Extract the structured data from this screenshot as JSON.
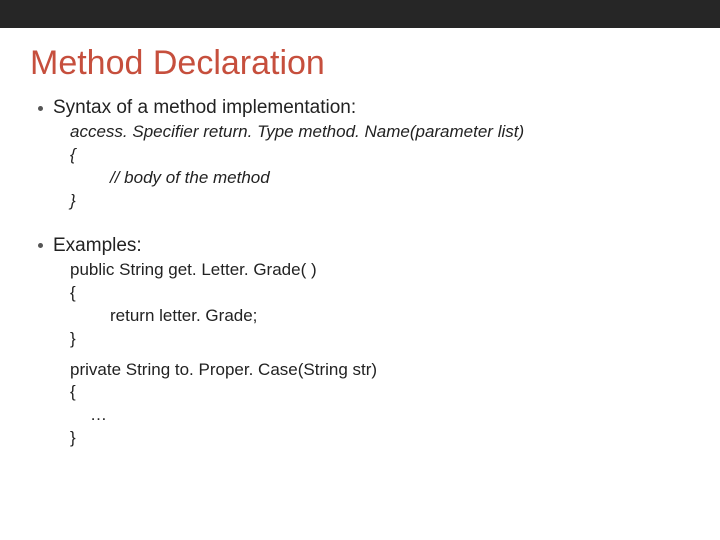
{
  "title": "Method Declaration",
  "bullet1": "Syntax of a method implementation:",
  "syntax": {
    "signature": "access. Specifier return. Type method. Name(parameter list)",
    "open": "{",
    "body": "// body of the method",
    "close": "}"
  },
  "bullet2": "Examples:",
  "example1": {
    "signature": "public String get. Letter. Grade( )",
    "open": "{",
    "body": "return letter. Grade;",
    "close": "}"
  },
  "example2": {
    "signature": "private String to. Proper. Case(String str)",
    "open": "{",
    "body": "…",
    "close": "}"
  }
}
